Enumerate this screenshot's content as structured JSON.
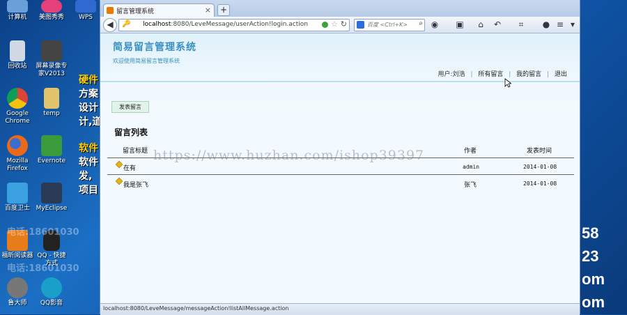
{
  "desktop": {
    "icons": [
      {
        "label": "计算机",
        "color": "#6aa0d8"
      },
      {
        "label": "美图秀秀",
        "color": "#e8407a"
      },
      {
        "label": "WPS",
        "color": "#2f6ad0"
      },
      {
        "label": "回收站",
        "color": "#cfd8e3"
      },
      {
        "label": "屏幕录像专家V2013",
        "color": "#444444"
      },
      {
        "label": "Google Chrome",
        "color": "#3d9b3a"
      },
      {
        "label": "temp",
        "color": "#e0c36a"
      },
      {
        "label": "Mozilla Firefox",
        "color": "#e86a1a"
      },
      {
        "label": "Evernote",
        "color": "#3a9b3a"
      },
      {
        "label": "百度卫士",
        "color": "#3aa0e0"
      },
      {
        "label": "MyEclipse",
        "color": "#2a3a55"
      },
      {
        "label": "福昕阅读器",
        "color": "#e67c1a"
      },
      {
        "label": "QQ - 快捷方式",
        "color": "#222222"
      },
      {
        "label": "鲁大师",
        "color": "#777777"
      },
      {
        "label": "QQ影音",
        "color": "#1aa0c8"
      }
    ],
    "ad_lines": [
      "硬件",
      "方案",
      "设计",
      "计,道",
      "软件",
      "软件",
      "发,",
      "项目"
    ],
    "side_watermarks": [
      "电话:18601030",
      "电话:18601030"
    ],
    "right_numbers": [
      "58",
      "23",
      "om",
      "om"
    ]
  },
  "browser": {
    "tab_title": "留言管理系统",
    "url_host": "localhost",
    "url_rest": ":8080/LeveMessage/userAction!login.action",
    "search_placeholder": "百度 <Ctrl+K>",
    "status_text": "localhost:8080/LeveMessage/messageAction!listAllMessage.action"
  },
  "page": {
    "site_title": "简易留言管理系统",
    "site_subtitle": "欢迎使用简易留言管理系统",
    "user_label": "用户:刘浩",
    "nav": [
      "所有留言",
      "我的留言",
      "退出"
    ],
    "post_button": "发表留言",
    "list_title": "留言列表",
    "table": {
      "headers": [
        "留言标题",
        "作者",
        "发表时间"
      ],
      "rows": [
        {
          "title": "在有",
          "author": "admin",
          "date": "2014-01-08"
        },
        {
          "title": "我是张飞",
          "author": "张飞",
          "date": "2014-01-08"
        }
      ]
    },
    "watermark": "https://www.huzhan.com/ishop39397"
  },
  "colors": {
    "accent": "#3a8fc2",
    "desktop": "#1b6fc4"
  }
}
